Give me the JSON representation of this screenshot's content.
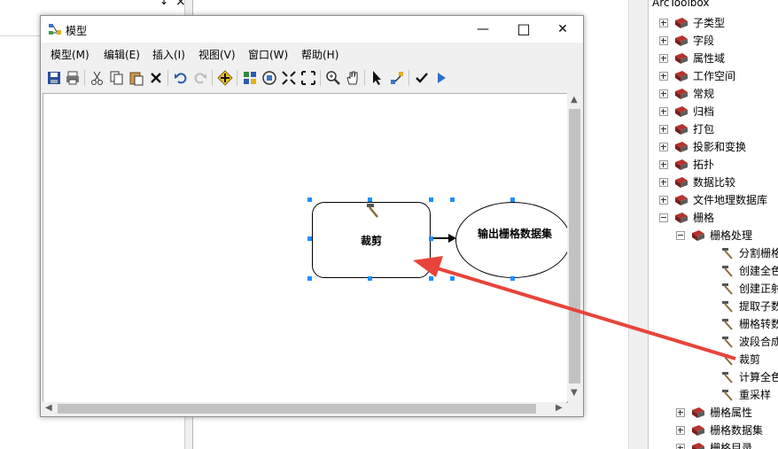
{
  "background_pane": {
    "pin_glyph": "↕",
    "close_glyph": "×"
  },
  "toolbox": {
    "title": "ArcToolbox",
    "items": [
      {
        "label": "子类型",
        "expanded": false,
        "level": 1
      },
      {
        "label": "字段",
        "expanded": false,
        "level": 1
      },
      {
        "label": "属性域",
        "expanded": false,
        "level": 1
      },
      {
        "label": "工作空间",
        "expanded": false,
        "level": 1
      },
      {
        "label": "常规",
        "expanded": false,
        "level": 1
      },
      {
        "label": "归档",
        "expanded": false,
        "level": 1
      },
      {
        "label": "打包",
        "expanded": false,
        "level": 1
      },
      {
        "label": "投影和变换",
        "expanded": false,
        "level": 1
      },
      {
        "label": "拓扑",
        "expanded": false,
        "level": 1
      },
      {
        "label": "数据比较",
        "expanded": false,
        "level": 1
      },
      {
        "label": "文件地理数据库",
        "expanded": false,
        "level": 1
      },
      {
        "label": "栅格",
        "expanded": true,
        "level": 1
      },
      {
        "label": "栅格处理",
        "expanded": true,
        "level": 2
      },
      {
        "label": "分割栅格",
        "level": 3,
        "tool": true
      },
      {
        "label": "创建全色",
        "level": 3,
        "tool": true
      },
      {
        "label": "创建正射",
        "level": 3,
        "tool": true
      },
      {
        "label": "提取子数",
        "level": 3,
        "tool": true
      },
      {
        "label": "栅格转数",
        "level": 3,
        "tool": true
      },
      {
        "label": "波段合成",
        "level": 3,
        "tool": true
      },
      {
        "label": "裁剪",
        "level": 3,
        "tool": true
      },
      {
        "label": "计算全色",
        "level": 3,
        "tool": true
      },
      {
        "label": "重采样",
        "level": 3,
        "tool": true
      },
      {
        "label": "栅格属性",
        "expanded": false,
        "level": 2
      },
      {
        "label": "栅格数据集",
        "expanded": false,
        "level": 2
      },
      {
        "label": "栅格目录",
        "expanded": false,
        "level": 2
      }
    ]
  },
  "window": {
    "title": "模型",
    "minimize_glyph": "—",
    "maximize_glyph": "□",
    "close_glyph": "✕",
    "menu": [
      "模型(M)",
      "编辑(E)",
      "插入(I)",
      "视图(V)",
      "窗口(W)",
      "帮助(H)"
    ]
  },
  "model": {
    "tool_name": "裁剪",
    "output_name": "输出栅格数据集"
  },
  "colors": {
    "annotation_arrow": "#e8443a",
    "selection_handle": "#1e90ff",
    "toolbox_icon": "#b5332c"
  },
  "icons": {
    "toolbar": [
      "save-icon",
      "print-icon",
      "cut-icon",
      "copy-icon",
      "paste-icon",
      "delete-icon",
      "undo-icon",
      "redo-icon",
      "add-data-icon",
      "auto-layout-icon",
      "full-extent-icon",
      "zoom-in-fixed-icon",
      "zoom-out-fixed-icon",
      "zoom-in-icon",
      "pan-icon",
      "select-icon",
      "connect-icon",
      "validate-icon",
      "run-icon"
    ]
  }
}
